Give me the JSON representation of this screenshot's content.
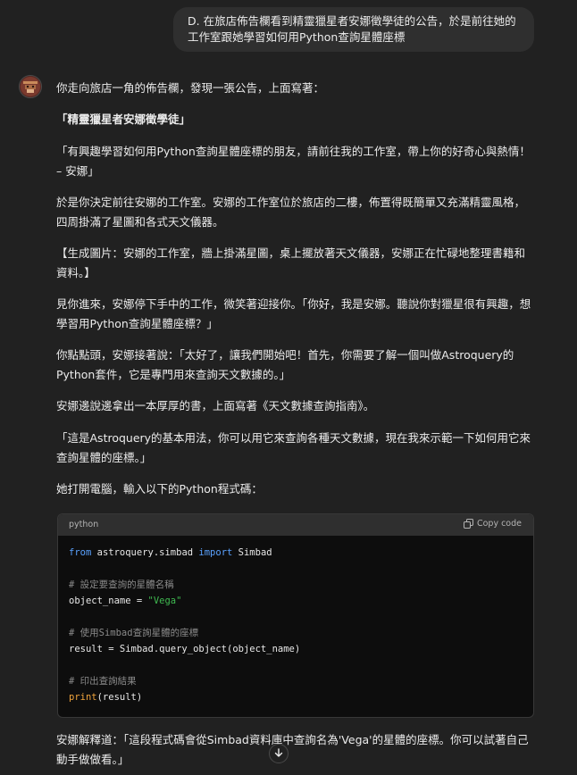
{
  "user_message": "D. 在旅店佈告欄看到精靈獵星者安娜徵學徒的公告，於是前往她的工作室跟她學習如何用Python查詢星體座標",
  "assistant": {
    "paragraphs": [
      "你走向旅店一角的佈告欄，發現一張公告，上面寫著：",
      "「精靈獵星者安娜徵學徒」",
      "「有興趣學習如何用Python查詢星體座標的朋友，請前往我的工作室，帶上你的好奇心與熱情！ – 安娜」",
      "於是你決定前往安娜的工作室。安娜的工作室位於旅店的二樓，佈置得既簡單又充滿精靈風格，四周掛滿了星圖和各式天文儀器。",
      "【生成圖片：安娜的工作室，牆上掛滿星圖，桌上擺放著天文儀器，安娜正在忙碌地整理書籍和資料。】",
      "見你進來，安娜停下手中的工作，微笑著迎接你。「你好，我是安娜。聽說你對獵星很有興趣，想學習用Python查詢星體座標？」",
      "你點點頭，安娜接著說：「太好了，讓我們開始吧！首先，你需要了解一個叫做Astroquery的Python套件，它是專門用來查詢天文數據的。」",
      "安娜邊說邊拿出一本厚厚的書，上面寫著《天文數據查詢指南》。",
      "「這是Astroquery的基本用法，你可以用它來查詢各種天文數據，現在我來示範一下如何用它來查詢星體的座標。」",
      "她打開電腦，輸入以下的Python程式碼：",
      "安娜解釋道：「這段程式碼會從Simbad資料庫中查詢名為'Vega'的星體的座標。你可以試著自己動手做做看。」"
    ]
  },
  "code": {
    "language": "python",
    "copy_label": "Copy code",
    "lines": {
      "l1_kw1": "from",
      "l1_mod": " astroquery.simbad ",
      "l1_kw2": "import",
      "l1_name": " Simbad",
      "l3_comment": "# 設定要查詢的星體名稱",
      "l4_pre": "object_name = ",
      "l4_str": "\"Vega\"",
      "l6_comment": "# 使用Simbad查詢星體的座標",
      "l7_text": "result = Simbad.query_object(object_name)",
      "l9_comment": "# 印出查詢結果",
      "l10_fn": "print",
      "l10_rest": "(result)"
    }
  },
  "icons": {
    "avatar": "assistant-avatar",
    "copy": "copy-icon",
    "scroll": "arrow-down-icon"
  }
}
